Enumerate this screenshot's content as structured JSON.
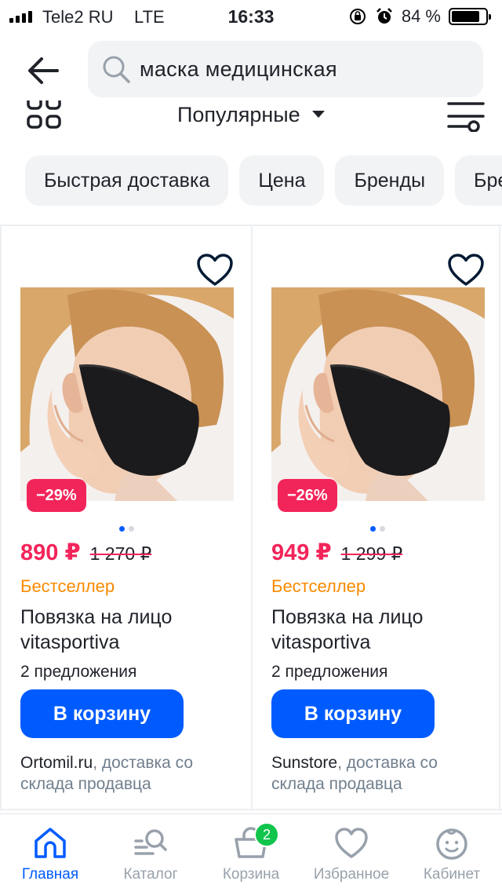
{
  "status_bar": {
    "carrier": "Tele2 RU",
    "network": "LTE",
    "time": "16:33",
    "battery_percent": "84 %",
    "battery_level": 0.84
  },
  "search": {
    "query": "маска медицинская"
  },
  "sort": {
    "label": "Популярные"
  },
  "filters": {
    "chips": [
      "Быстрая доставка",
      "Цена",
      "Бренды",
      "Бренды"
    ]
  },
  "products": [
    {
      "discount": "−29%",
      "price": "890 ₽",
      "old_price": "1 270 ₽",
      "badge": "Бестселлер",
      "title": "Повязка на лицо vitasportiva",
      "offers": "2 предложения",
      "cart_button": "В корзину",
      "seller": "Ortomil.ru",
      "delivery": ", доставка со склада продавца"
    },
    {
      "discount": "−26%",
      "price": "949 ₽",
      "old_price": "1 299 ₽",
      "badge": "Бестселлер",
      "title": "Повязка на лицо vitasportiva",
      "offers": "2 предложения",
      "cart_button": "В корзину",
      "seller": "Sunstore",
      "delivery": ", доставка со склада продавца"
    }
  ],
  "tab_bar": {
    "tabs": [
      {
        "label": "Главная",
        "icon": "home-icon",
        "active": true
      },
      {
        "label": "Каталог",
        "icon": "catalog-icon",
        "active": false
      },
      {
        "label": "Корзина",
        "icon": "cart-icon",
        "active": false,
        "badge": "2"
      },
      {
        "label": "Избранное",
        "icon": "heart-icon",
        "active": false
      },
      {
        "label": "Кабинет",
        "icon": "profile-icon",
        "active": false
      }
    ]
  },
  "colors": {
    "accent": "#005bff",
    "price": "#f2255a",
    "bestseller": "#f98a00",
    "cart_badge": "#10c44c"
  }
}
